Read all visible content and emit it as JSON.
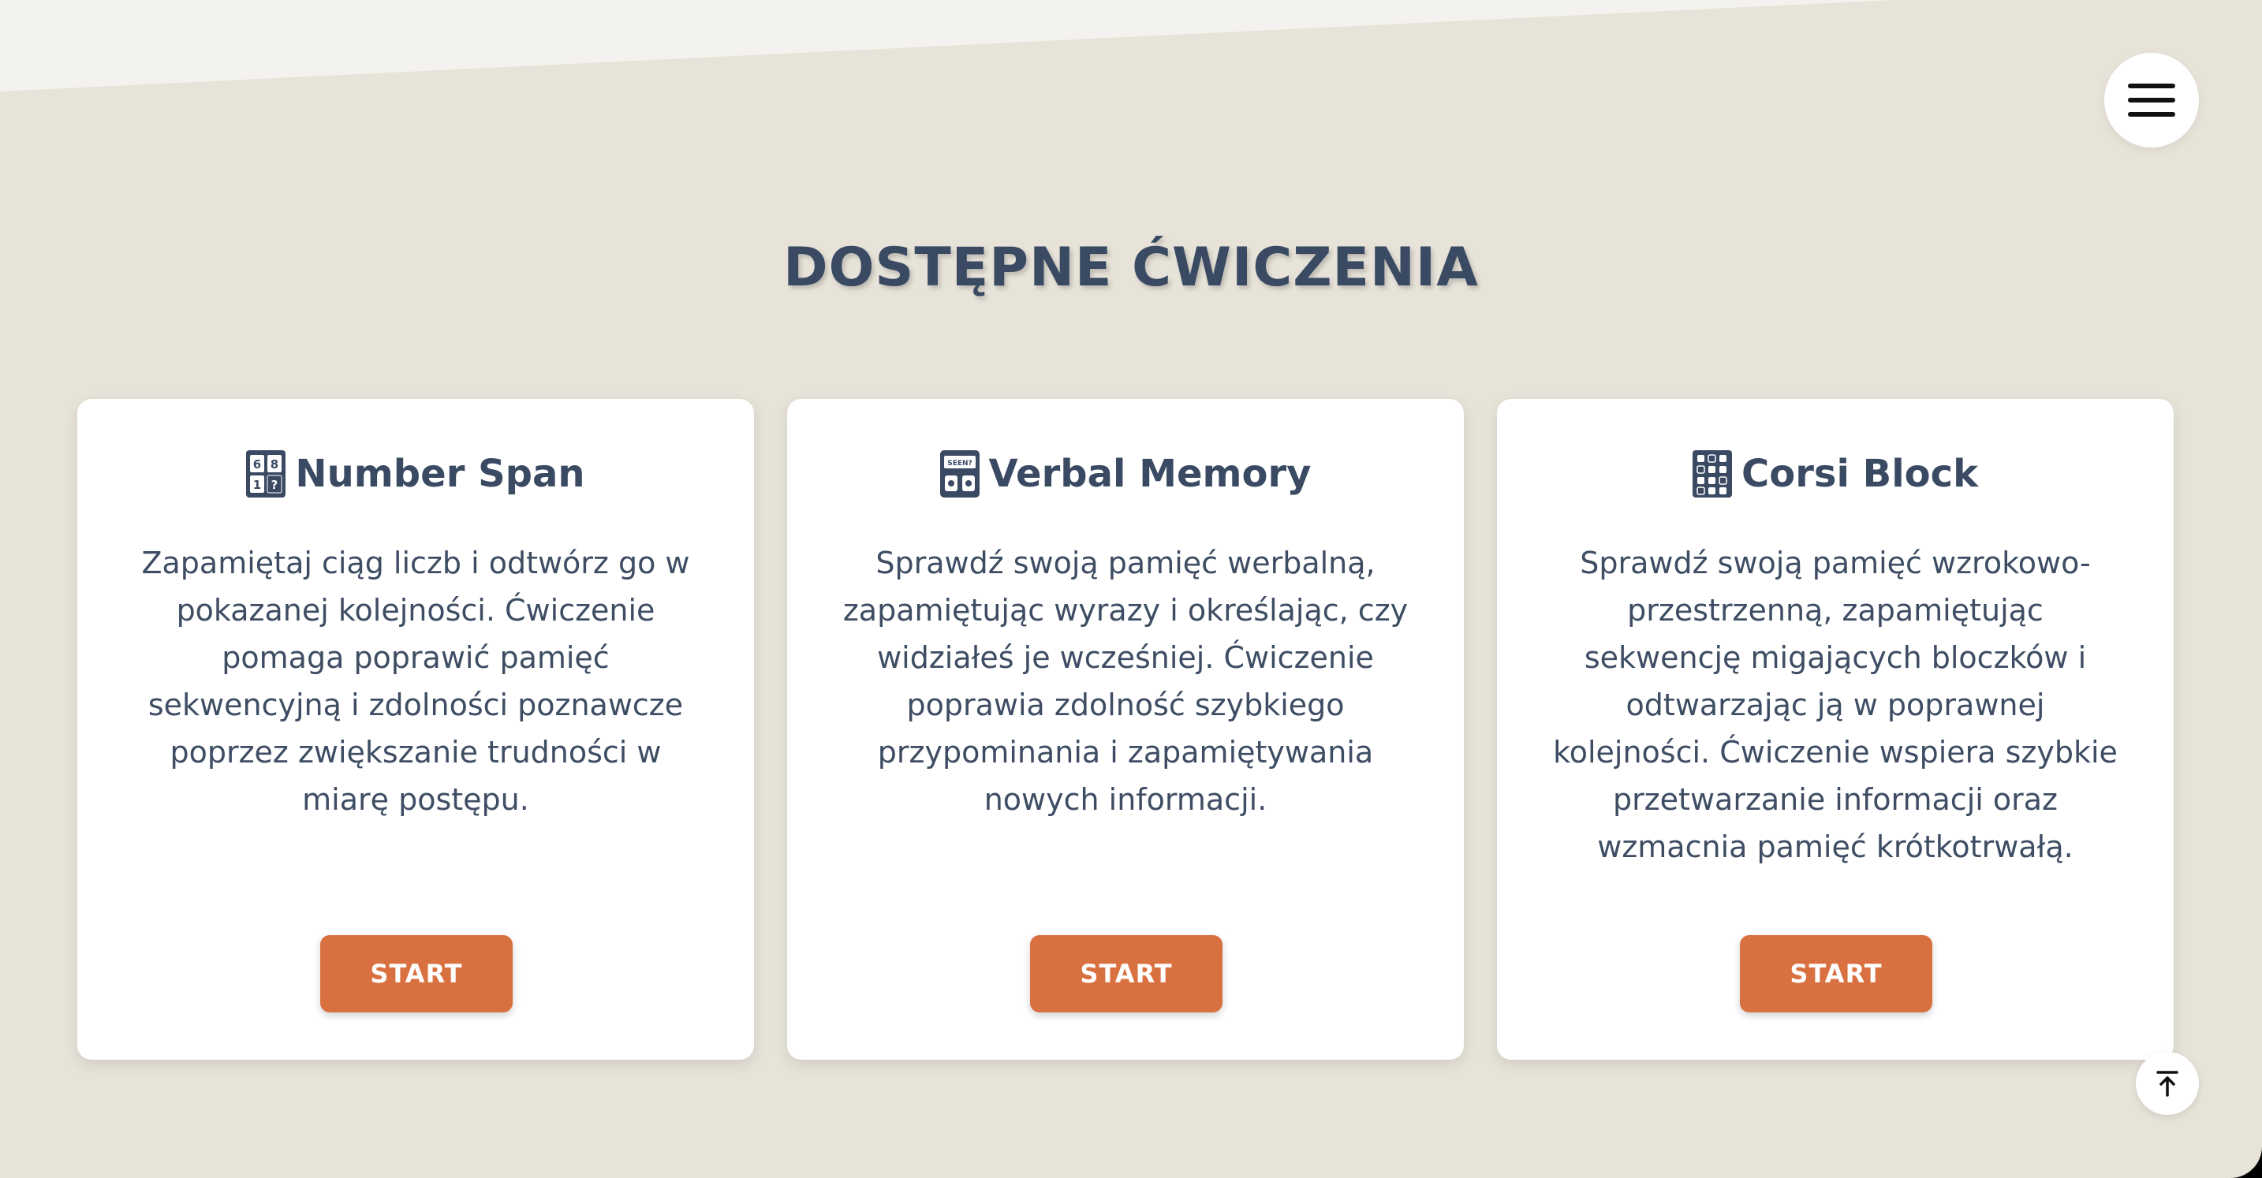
{
  "page": {
    "title": "DOSTĘPNE ĆWICZENIA"
  },
  "header": {
    "menu_icon": "hamburger-menu-icon"
  },
  "cards": [
    {
      "icon": "number-grid-icon",
      "title": "Number Span",
      "description": "Zapamiętaj ciąg liczb i odtwórz go w pokazanej kolejności. Ćwiczenie pomaga poprawić pamięć sekwencyjną i zdolności poznawcze poprzez zwiększanie trudności w miarę postępu.",
      "button_label": "START"
    },
    {
      "icon": "seen-cards-icon",
      "title": "Verbal Memory",
      "description": "Sprawdź swoją pamięć werbalną, zapamiętując wyrazy i określając, czy widziałeś je wcześniej. Ćwiczenie poprawia zdolność szybkiego przypominania i zapamiętywania nowych informacji.",
      "button_label": "START"
    },
    {
      "icon": "block-grid-icon",
      "title": "Corsi Block",
      "description": "Sprawdź swoją pamięć wzrokowo-przestrzenną, zapamiętując sekwencję migających bloczków i odtwarzając ją w poprawnej kolejności. Ćwiczenie wspiera szybkie przetwarzanie informacji oraz wzmacnia pamięć krótkotrwałą.",
      "button_label": "START"
    }
  ],
  "footer": {
    "scroll_top_icon": "arrow-up-to-top-icon"
  },
  "colors": {
    "background": "#e7e3d9",
    "top_band": "#f4f2ee",
    "card": "#ffffff",
    "heading": "#3a4a63",
    "body_text": "#3e4d63",
    "accent": "#d8703f"
  }
}
